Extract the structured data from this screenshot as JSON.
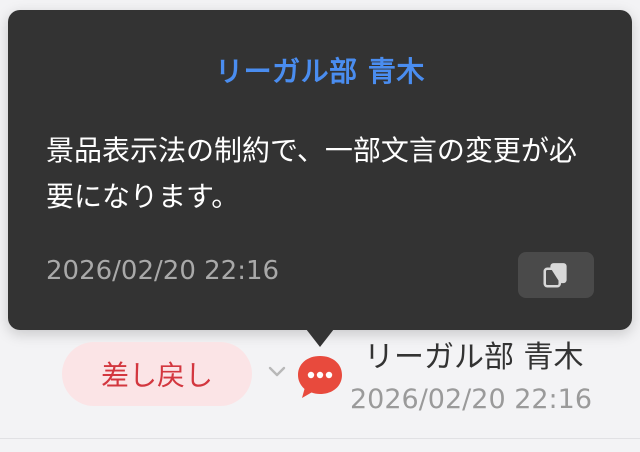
{
  "popover": {
    "author": "リーガル部 青木",
    "message": "景品表示法の制約で、一部文言の変更が必要になります。",
    "timestamp": "2026/02/20 22:16",
    "copy_icon": "copy-icon"
  },
  "row": {
    "status_label": "差し戻し",
    "chevron_icon": "chevron-down-icon",
    "comment_icon": "chat-bubble-dots-icon",
    "author": "リーガル部 青木",
    "timestamp": "2026/02/20 22:16"
  },
  "colors": {
    "popover_bg": "#333333",
    "author_accent": "#4a8df0",
    "status_bg": "#fbe4e6",
    "status_text": "#d3373f",
    "comment_icon": "#e84a3d"
  }
}
